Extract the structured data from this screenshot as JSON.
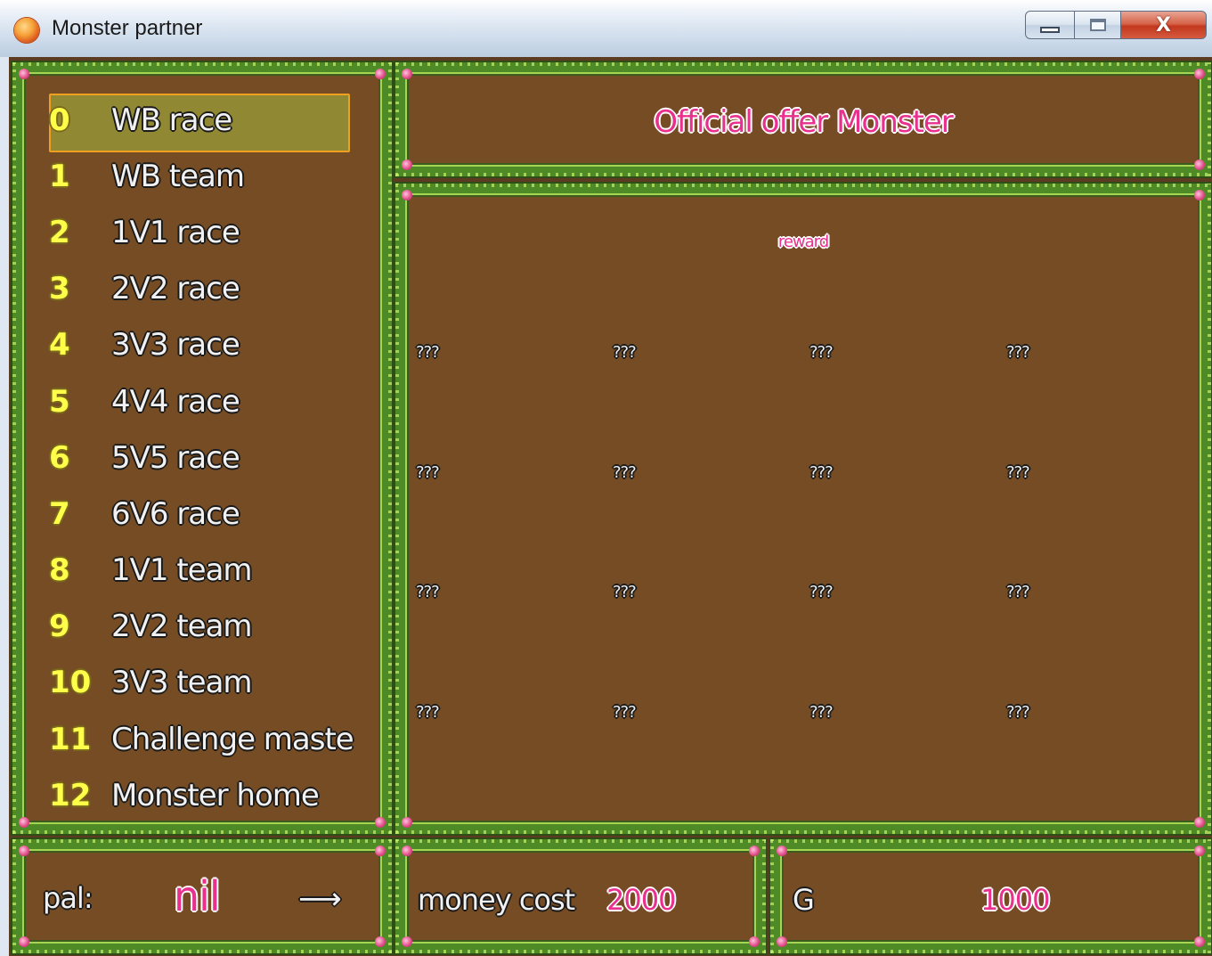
{
  "window": {
    "title": "Monster partner",
    "min_symbol": "",
    "max_symbol": "",
    "close_symbol": "X"
  },
  "menu": {
    "selected_index": 0,
    "items": [
      {
        "num": "0",
        "label": "WB race"
      },
      {
        "num": "1",
        "label": "WB team"
      },
      {
        "num": "2",
        "label": "1V1 race"
      },
      {
        "num": "3",
        "label": "2V2 race"
      },
      {
        "num": "4",
        "label": "3V3 race"
      },
      {
        "num": "5",
        "label": "4V4 race"
      },
      {
        "num": "6",
        "label": "5V5 race"
      },
      {
        "num": "7",
        "label": "6V6 race"
      },
      {
        "num": "8",
        "label": "1V1 team"
      },
      {
        "num": "9",
        "label": "2V2 team"
      },
      {
        "num": "10",
        "label": "3V3 team"
      },
      {
        "num": "11",
        "label": "Challenge maste"
      },
      {
        "num": "12",
        "label": "Monster home"
      }
    ]
  },
  "header": {
    "title": "Official offer Monster"
  },
  "reward": {
    "label": "reward",
    "slots": [
      [
        "???",
        "???",
        "???",
        "???"
      ],
      [
        "???",
        "???",
        "???",
        "???"
      ],
      [
        "???",
        "???",
        "???",
        "???"
      ],
      [
        "???",
        "???",
        "???",
        "???"
      ]
    ]
  },
  "footer": {
    "pal_label": "pal:",
    "pal_value": "nil",
    "arrow": "⟶",
    "money_label": "money cost",
    "money_value": "2000",
    "g_label": "G",
    "g_value": "1000"
  },
  "colors": {
    "panel_brown": "#754c24",
    "vine_green": "#4e8a25",
    "highlight": "#f0a020",
    "accent_pink": "#e8308c",
    "number_yellow": "#ffff4a"
  }
}
